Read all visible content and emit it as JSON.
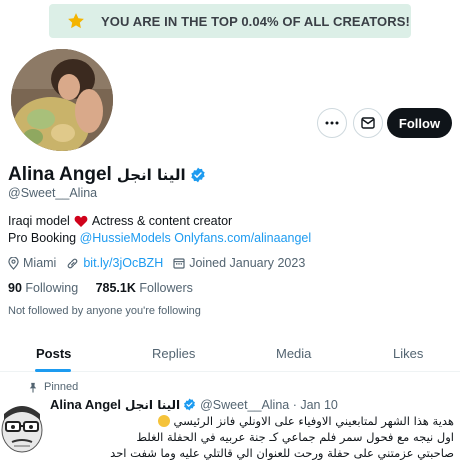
{
  "banner": {
    "text": "YOU ARE IN THE TOP 0.04% OF ALL CREATORS!",
    "icon": "star-icon"
  },
  "profile": {
    "display_name": "Alina Angel",
    "arabic_name": "الينا انجل",
    "handle": "@Sweet__Alina",
    "verified": true,
    "bio_line1_a": "Iraqi model",
    "bio_line1_b": "Actress & content creator",
    "bio_line2_prefix": "Pro Booking",
    "bio_link1": "@HussieModels",
    "bio_link2": "Onlyfans.com/alinaangel",
    "location": "Miami",
    "website": "bit.ly/3jOcBZH",
    "joined": "Joined January 2023",
    "following_count": "90",
    "following_label": "Following",
    "followers_count": "785.1K",
    "followers_label": "Followers",
    "not_followed": "Not followed by anyone you're following"
  },
  "actions": {
    "follow_label": "Follow",
    "more_icon": "more-icon",
    "message_icon": "message-icon"
  },
  "tabs": [
    {
      "label": "Posts",
      "active": true
    },
    {
      "label": "Replies",
      "active": false
    },
    {
      "label": "Media",
      "active": false
    },
    {
      "label": "Likes",
      "active": false
    }
  ],
  "post": {
    "pinned_label": "Pinned",
    "author": "Alina Angel",
    "author_arabic": "الينا انجل",
    "handle_date": "@Sweet__Alina · Jan 10",
    "line1": "هدية هذا الشهر لمتابعيني الاوفياء على الاونلي فانز الرئيسي",
    "line2": "اول نيجه مع فحول سمر فلم جماعي كـ جنة عربيه في الحفلة الغلط",
    "line3": "صاحبتي عزمتني على حفلة ورحت للعنوان الي قالتلي عليه وما شفت احد"
  },
  "colors": {
    "accent": "#1d9bf0",
    "banner_bg": "#dcefe7",
    "star": "#f4b400",
    "follow_bg": "#0f1419",
    "heart": "#d0021b"
  }
}
